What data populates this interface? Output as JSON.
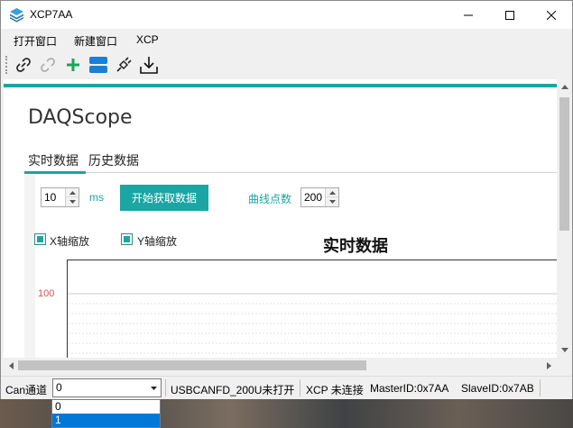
{
  "window": {
    "title": "XCP7AA",
    "controls": [
      "minimize",
      "maximize",
      "close"
    ]
  },
  "menu": {
    "items": [
      "打开窗口",
      "新建窗口",
      "XCP"
    ]
  },
  "toolbar": {
    "icons": [
      "link-icon",
      "unlink-icon",
      "add-icon",
      "list-icon",
      "plug-icon",
      "download-icon"
    ]
  },
  "main": {
    "title": "DAQScope",
    "tabs": [
      {
        "label": "实时数据",
        "active": true
      },
      {
        "label": "历史数据",
        "active": false
      }
    ],
    "interval": {
      "value": "10",
      "unit": "ms"
    },
    "start_button": "开始获取数据",
    "curve_points": {
      "label": "曲线点数",
      "value": "200"
    },
    "x_zoom": {
      "label": "X轴缩放",
      "checked": true
    },
    "y_zoom": {
      "label": "Y轴缩放",
      "checked": true
    }
  },
  "chart_data": {
    "type": "line",
    "title": "实时数据",
    "series": [],
    "yticks": [
      100
    ],
    "grid": true
  },
  "status": {
    "can_label": "Can通道",
    "can_value": "0",
    "device": "USBCANFD_200U未打开",
    "xcp": "XCP 未连接",
    "master": "MasterID:0x7AA",
    "slave": "SlaveID:0x7AB"
  },
  "dropdown": {
    "options": [
      "0",
      "1"
    ],
    "selected_index": 1
  },
  "colors": {
    "accent": "#1ba5a3",
    "selection": "#0078d7",
    "ytick": "#d9534f"
  }
}
